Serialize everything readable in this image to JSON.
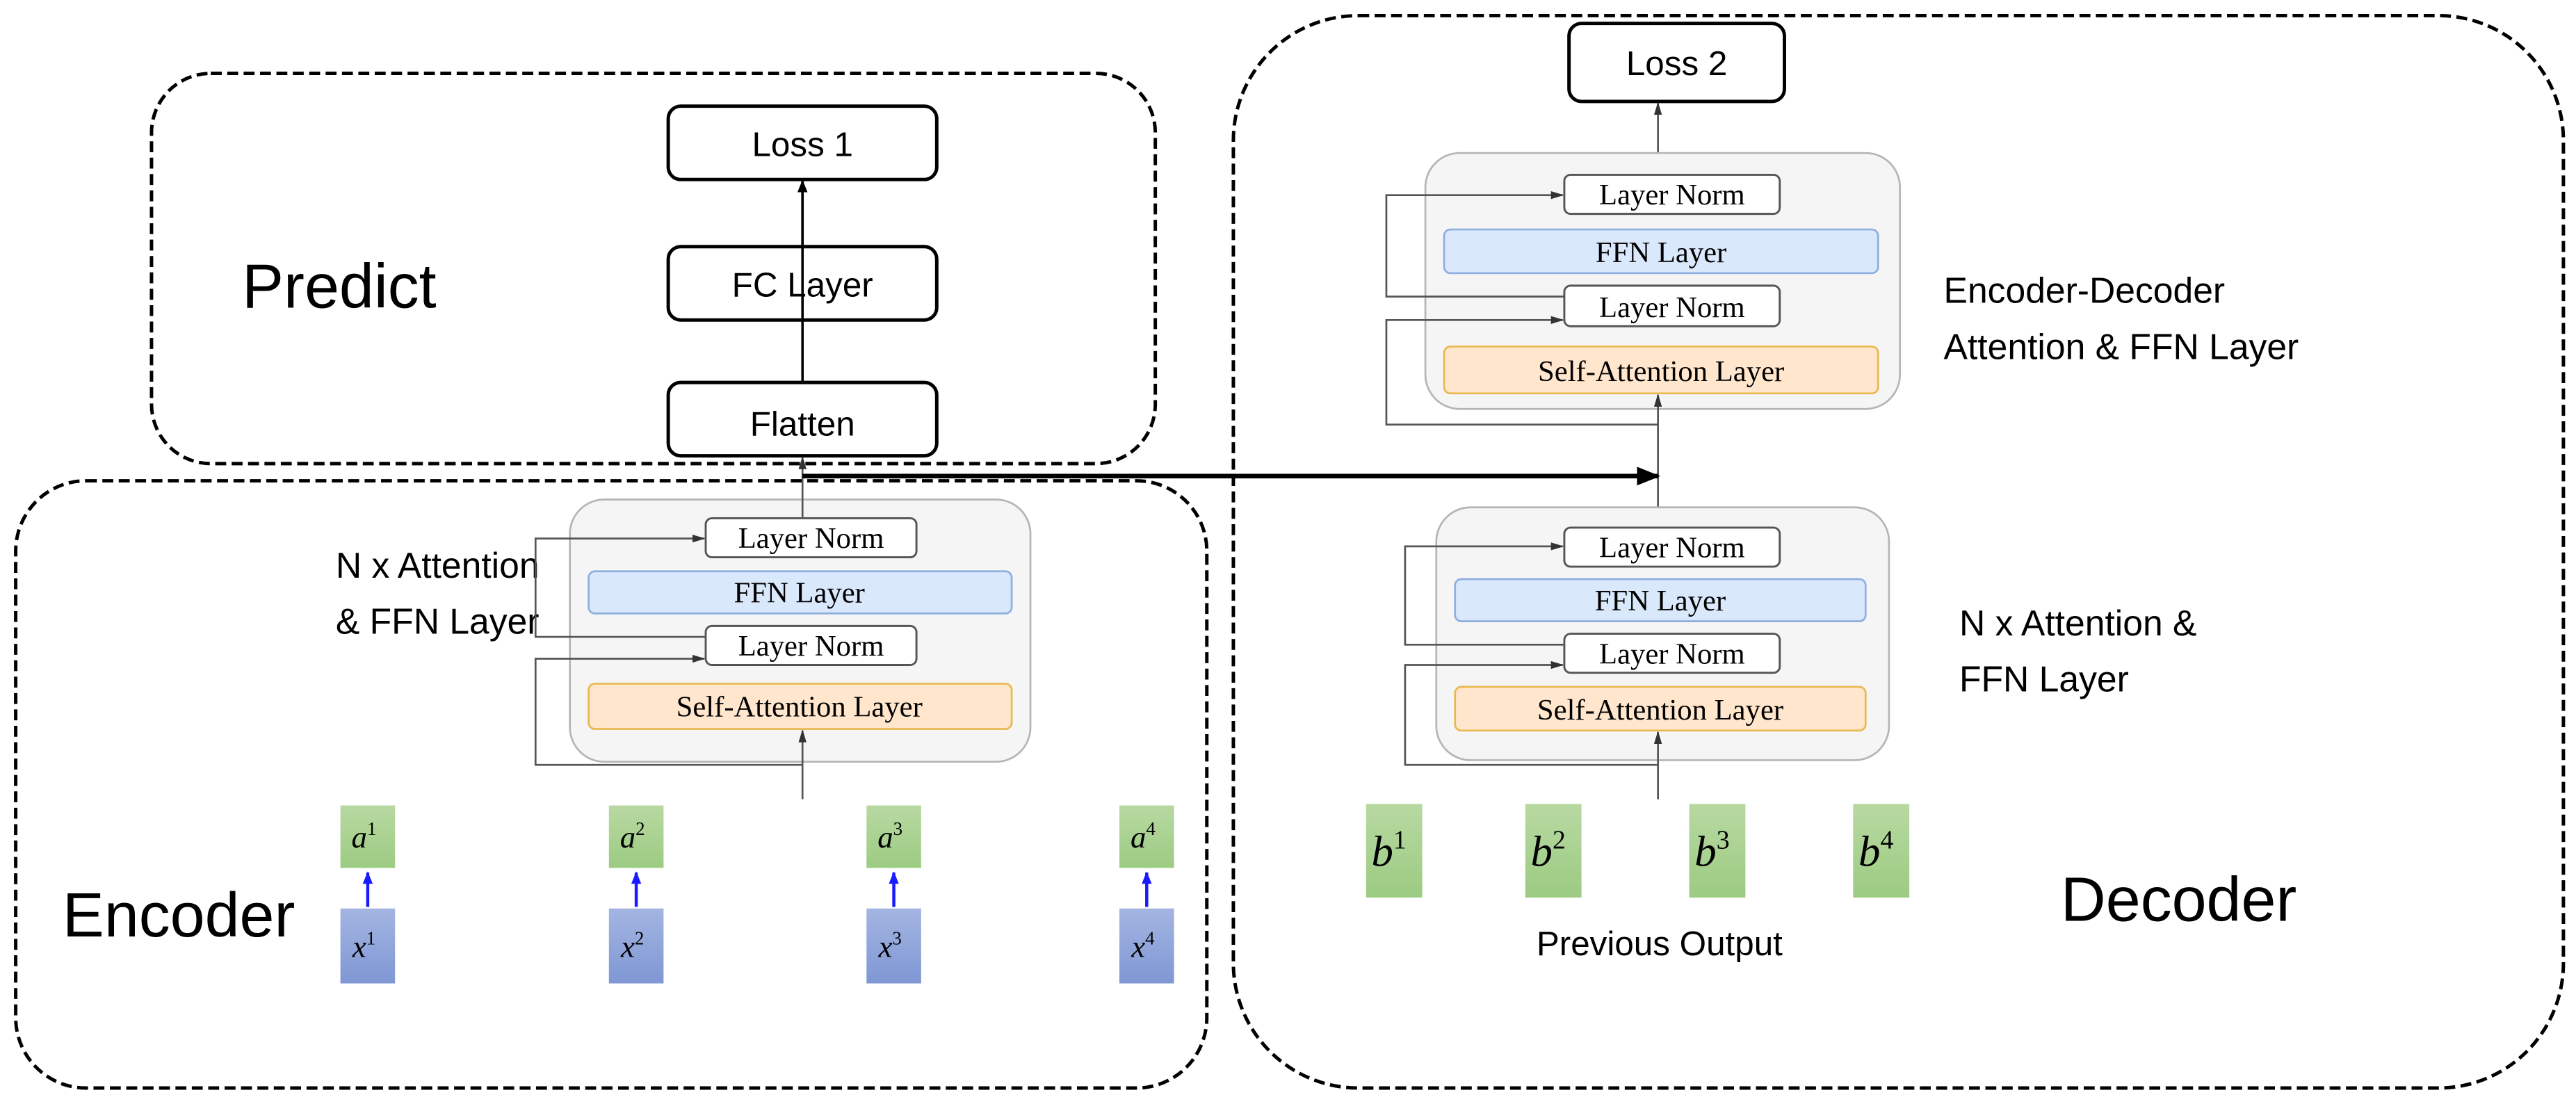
{
  "predict": {
    "title": "Predict",
    "loss": "Loss 1",
    "fc": "FC Layer",
    "flatten": "Flatten"
  },
  "encoder": {
    "title": "Encoder",
    "block_label_line1": "N x Attention",
    "block_label_line2": "& FFN Layer",
    "layer_norm_top": "Layer Norm",
    "ffn": "FFN Layer",
    "layer_norm_bottom": "Layer Norm",
    "self_attention": "Self-Attention Layer",
    "outputs": [
      {
        "base": "a",
        "sup": "1"
      },
      {
        "base": "a",
        "sup": "2"
      },
      {
        "base": "a",
        "sup": "3"
      },
      {
        "base": "a",
        "sup": "4"
      }
    ],
    "inputs": [
      {
        "base": "x",
        "sup": "1"
      },
      {
        "base": "x",
        "sup": "2"
      },
      {
        "base": "x",
        "sup": "3"
      },
      {
        "base": "x",
        "sup": "4"
      }
    ]
  },
  "decoder": {
    "title": "Decoder",
    "loss": "Loss 2",
    "cross_block_label_line1": "Encoder-Decoder",
    "cross_block_label_line2": "Attention & FFN Layer",
    "cross_block": {
      "layer_norm_top": "Layer Norm",
      "ffn": "FFN Layer",
      "layer_norm_bottom": "Layer Norm",
      "self_attention": "Self-Attention Layer"
    },
    "self_block_label_line1": "N x Attention &",
    "self_block_label_line2": "FFN Layer",
    "self_block": {
      "layer_norm_top": "Layer Norm",
      "ffn": "FFN Layer",
      "layer_norm_bottom": "Layer Norm",
      "self_attention": "Self-Attention Layer"
    },
    "previous_outputs": [
      {
        "base": "b",
        "sup": "1"
      },
      {
        "base": "b",
        "sup": "2"
      },
      {
        "base": "b",
        "sup": "3"
      },
      {
        "base": "b",
        "sup": "4"
      }
    ],
    "previous_output_label": "Previous Output"
  },
  "colors": {
    "ffn_fill": "#dae8fc",
    "self_attention_fill": "#ffe6cc",
    "token_green": "#a9d18e",
    "token_blue": "#8fa5db",
    "block_gray": "#f5f5f5"
  }
}
